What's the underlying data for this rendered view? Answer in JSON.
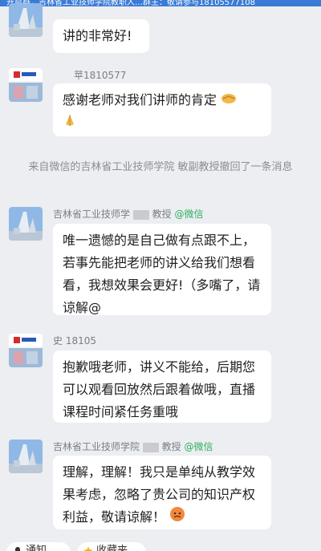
{
  "top_banner": {
    "text": "开启群，吉林省工业技师学院教职人…群主：敬请参与18105577108"
  },
  "messages": [
    {
      "id": "m1",
      "type": "message",
      "avatar": "building",
      "sender": "",
      "text": "讲的非常好!"
    },
    {
      "id": "m2",
      "type": "message",
      "avatar": "logo",
      "sender": "苹1810577",
      "text": "感谢老师对我们讲师的肯定"
    },
    {
      "id": "m3",
      "type": "system",
      "text": "来自微信的吉林省工业技师学院 敏副教授撤回了一条消息"
    },
    {
      "id": "m4",
      "type": "message",
      "avatar": "building",
      "sender": "吉林省工业技师学",
      "sender_suffix": "教授",
      "source": "@微信",
      "text": "唯一遗憾的是自己做有点跟不上，若事先能把老师的讲义给我们想看看，我想效果会更好!（多嘴了，请谅解@"
    },
    {
      "id": "m5",
      "type": "message",
      "avatar": "logo",
      "sender": "史 18105",
      "text": "抱歉哦老师，讲义不能给，后期您可以观看回放然后跟着做哦，直播课程时间紧任务重哦"
    },
    {
      "id": "m6",
      "type": "message",
      "avatar": "building",
      "sender": "吉林省工业技师学院",
      "sender_suffix": "教授",
      "source": "@微信",
      "text": "理解，理解！我只是单纯从教学效果考虑，忽略了贵公司的知识产权利益，敬请谅解！"
    }
  ],
  "bottom_actions": [
    {
      "label": "通知",
      "icon": "bell-icon"
    },
    {
      "label": "收藏夹",
      "icon": "star-icon"
    }
  ],
  "colors": {
    "background": "#eceef1",
    "bubble": "#ffffff",
    "source_green": "#2fae60",
    "banner": "#3a7bd5"
  }
}
